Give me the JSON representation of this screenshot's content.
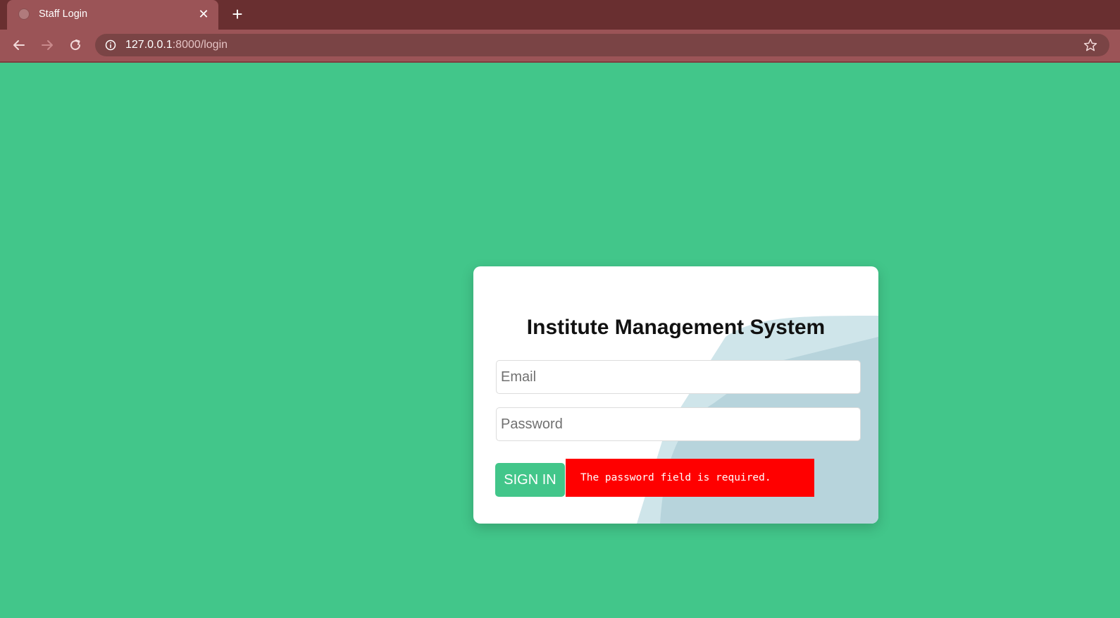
{
  "browser": {
    "tab": {
      "title": "Staff Login",
      "favicon": "globe-icon",
      "close_icon": "close-icon"
    },
    "new_tab_icon": "plus-icon",
    "nav": {
      "back_icon": "arrow-left-icon",
      "forward_icon": "arrow-right-icon",
      "reload_icon": "reload-icon"
    },
    "address": {
      "host": "127.0.0.1",
      "rest": ":8000/login",
      "info_icon": "info-icon",
      "bookmark_icon": "star-icon"
    },
    "colors": {
      "tabstrip": "#692f30",
      "toolbar": "#9b5457",
      "omnibox": "#7a4445"
    }
  },
  "page": {
    "background": "#42c68a"
  },
  "login": {
    "title": "Institute Management System",
    "email_placeholder": "Email",
    "password_placeholder": "Password",
    "signin_label": "SIGN IN",
    "error_message": "The password field is required.",
    "colors": {
      "button": "#42c68a",
      "error": "#ff0000",
      "deco_light": "#cfe5ea",
      "deco_dark": "#b7d4dc"
    }
  }
}
